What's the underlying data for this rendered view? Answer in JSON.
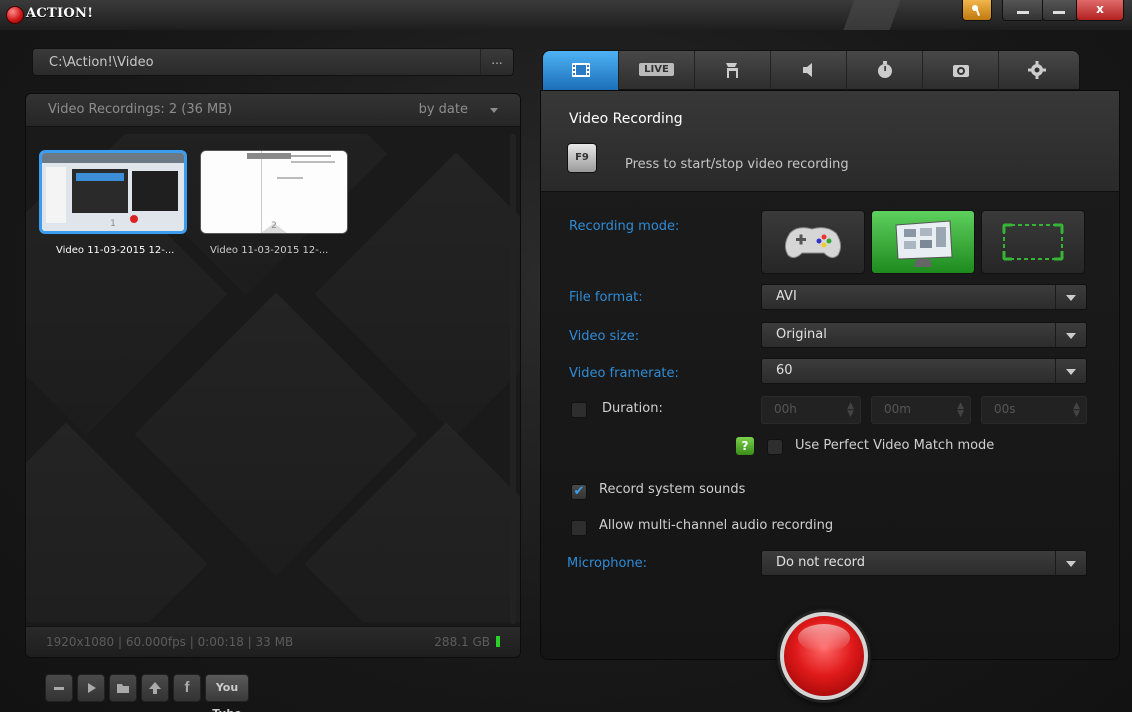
{
  "window": {
    "title": "ACTION!",
    "close_label": "x"
  },
  "library": {
    "path": "C:\\Action!\\Video",
    "browse_label": "...",
    "count_label": "Video Recordings: 2 (36 MB)",
    "sort_label": "by date",
    "items": [
      {
        "label": "Video 11-03-2015 12-...",
        "number": "1"
      },
      {
        "label": "Video 11-03-2015 12-...",
        "number": "2"
      }
    ],
    "footer_info": "1920x1080 | 60.000fps | 0:00:18 | 33 MB",
    "disk_free": "288.1 GB",
    "toolbar": [
      "minus-icon",
      "play-icon",
      "folder-icon",
      "upload-icon",
      "facebook-icon",
      "youtube-icon"
    ],
    "facebook_label": "f",
    "youtube_label": "You Tube"
  },
  "tabs": [
    "video-tab",
    "live-tab",
    "game-tab",
    "audio-tab",
    "timer-tab",
    "screenshot-tab",
    "settings-tab"
  ],
  "live_label": "LIVE",
  "recording": {
    "title": "Video Recording",
    "hotkey": "F9",
    "hotkey_desc": "Press to start/stop video recording",
    "mode_label": "Recording mode:",
    "format_label": "File format:",
    "format_value": "AVI",
    "size_label": "Video size:",
    "size_value": "Original",
    "framerate_label": "Video framerate:",
    "framerate_value": "60",
    "duration_label": "Duration:",
    "duration_hours": "00h",
    "duration_minutes": "00m",
    "duration_seconds": "00s",
    "help_label": "?",
    "perfect_match_label": "Use Perfect Video Match mode",
    "system_sounds_label": "Record system sounds",
    "multichannel_label": "Allow multi-channel audio recording",
    "microphone_label": "Microphone:",
    "microphone_value": "Do not record"
  },
  "colors": {
    "accent": "#2e8bd6",
    "active_tab": "#3a9ae8",
    "record": "#e01a1a",
    "selected_mode": "#2aa52a"
  }
}
